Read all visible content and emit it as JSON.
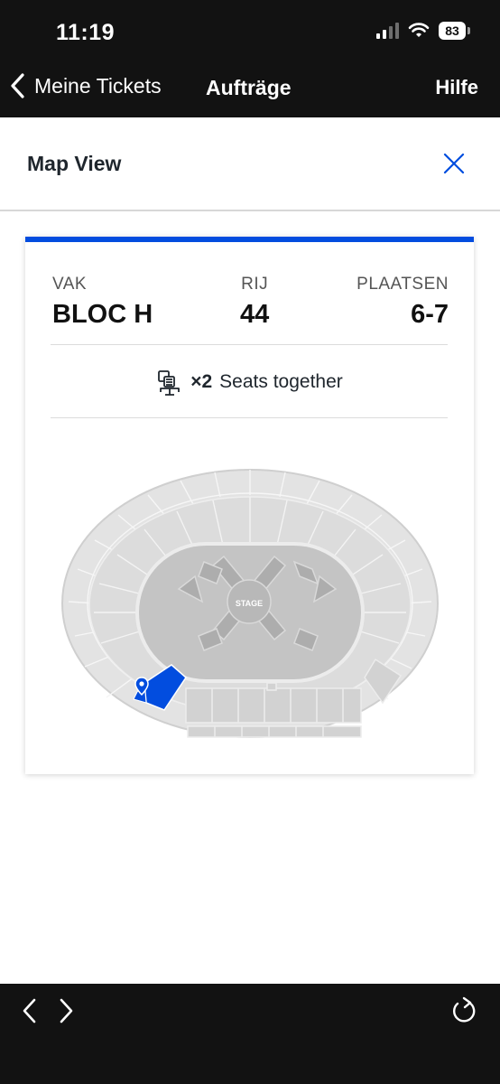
{
  "status_bar": {
    "time": "11:19",
    "battery": "83"
  },
  "nav": {
    "back_label": "Meine Tickets",
    "title": "Aufträge",
    "help_label": "Hilfe"
  },
  "sheet": {
    "title": "Map View"
  },
  "ticket": {
    "section_label": "VAK",
    "section_value": "BLOC H",
    "row_label": "RIJ",
    "row_value": "44",
    "seats_label": "PLAATSEN",
    "seats_value": "6-7",
    "together_count": "×2",
    "together_text": "Seats together"
  },
  "map": {
    "stage_label": "STAGE",
    "highlight_color": "#024ddf"
  },
  "colors": {
    "accent": "#024ddf",
    "bar_background": "#121212"
  },
  "icons": [
    "chevron-left-icon",
    "close-icon",
    "seats-together-icon",
    "location-pin-icon",
    "arrow-left-icon",
    "arrow-right-icon",
    "reload-icon"
  ]
}
